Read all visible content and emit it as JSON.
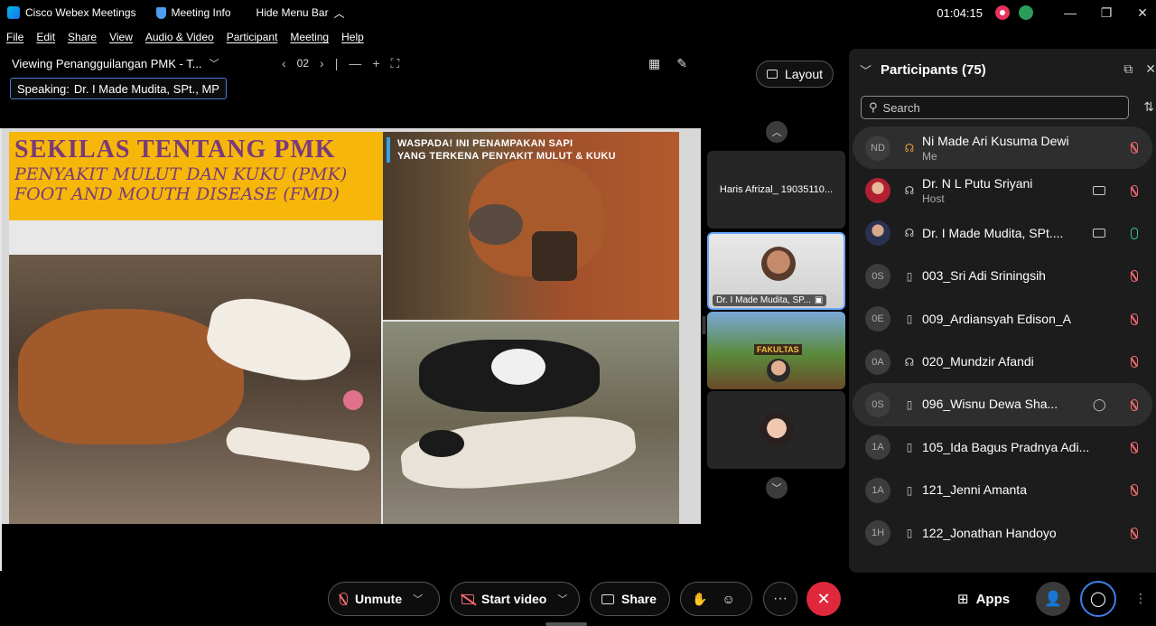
{
  "titlebar": {
    "app_name": "Cisco Webex Meetings",
    "meeting_info": "Meeting Info",
    "hide_menu": "Hide Menu Bar",
    "timer": "01:04:15",
    "minimize": "—",
    "restore": "❐",
    "close": "✕"
  },
  "menu": [
    "File",
    "Edit",
    "Share",
    "View",
    "Audio & Video",
    "Participant",
    "Meeting",
    "Help"
  ],
  "share_bar": {
    "viewing": "Viewing Penangguilangan PMK - T...",
    "page": "02"
  },
  "speaking": {
    "label": "Speaking:",
    "name": "Dr. I Made Mudita, SPt., MP"
  },
  "slide": {
    "title": "SEKILAS TENTANG PMK",
    "subtitle1": "PENYAKIT MULUT DAN KUKU (PMK)",
    "subtitle2": "FOOT AND MOUTH DISEASE (FMD)",
    "caption_line1": "WASPADA! INI PENAMPAKAN SAPI",
    "caption_line2": "YANG TERKENA PENYAKIT MULUT & KUKU",
    "building_sign": "FAKULTAS"
  },
  "layout_button": "Layout",
  "thumbnails": [
    {
      "name": "Haris Afrizal_ 19035110..."
    },
    {
      "name": "Dr. I Made Mudita, SP..."
    }
  ],
  "participants": {
    "title": "Participants (75)",
    "search_placeholder": "Search",
    "list": [
      {
        "initials": "ND",
        "name": "Ni Made Ari Kusuma Dewi",
        "sub": "Me",
        "device": "headset",
        "mic": "muted",
        "video": false,
        "highlight": true
      },
      {
        "initials": "",
        "name": "Dr. N L Putu Sriyani",
        "sub": "Host",
        "device": "headset",
        "mic": "muted",
        "video": true
      },
      {
        "initials": "",
        "name": "Dr. I Made Mudita, SPt....",
        "sub": "",
        "device": "headset",
        "mic": "on",
        "video": true
      },
      {
        "initials": "0S",
        "name": "003_Sri Adi Sriningsih",
        "sub": "",
        "device": "phone",
        "mic": "muted",
        "video": false
      },
      {
        "initials": "0E",
        "name": "009_Ardiansyah Edison_A",
        "sub": "",
        "device": "phone",
        "mic": "muted",
        "video": false
      },
      {
        "initials": "0A",
        "name": "020_Mundzir Afandi",
        "sub": "",
        "device": "headset",
        "mic": "muted",
        "video": false
      },
      {
        "initials": "0S",
        "name": "096_Wisnu Dewa Sha...",
        "sub": "",
        "device": "phone",
        "mic": "muted",
        "video": false,
        "chat": true,
        "highlight": true
      },
      {
        "initials": "1A",
        "name": "105_Ida Bagus Pradnya Adi...",
        "sub": "",
        "device": "phone",
        "mic": "muted",
        "video": false
      },
      {
        "initials": "1A",
        "name": "121_Jenni Amanta",
        "sub": "",
        "device": "phone",
        "mic": "muted",
        "video": false
      },
      {
        "initials": "1H",
        "name": "122_Jonathan Handoyo",
        "sub": "",
        "device": "phone",
        "mic": "muted",
        "video": false
      }
    ]
  },
  "controls": {
    "unmute": "Unmute",
    "start_video": "Start video",
    "share": "Share",
    "apps": "Apps"
  },
  "colors": {
    "accent": "#3f7ee8",
    "muted_red": "#f06a70",
    "end_red": "#e0283c",
    "banner_yellow": "#f6b70a"
  }
}
